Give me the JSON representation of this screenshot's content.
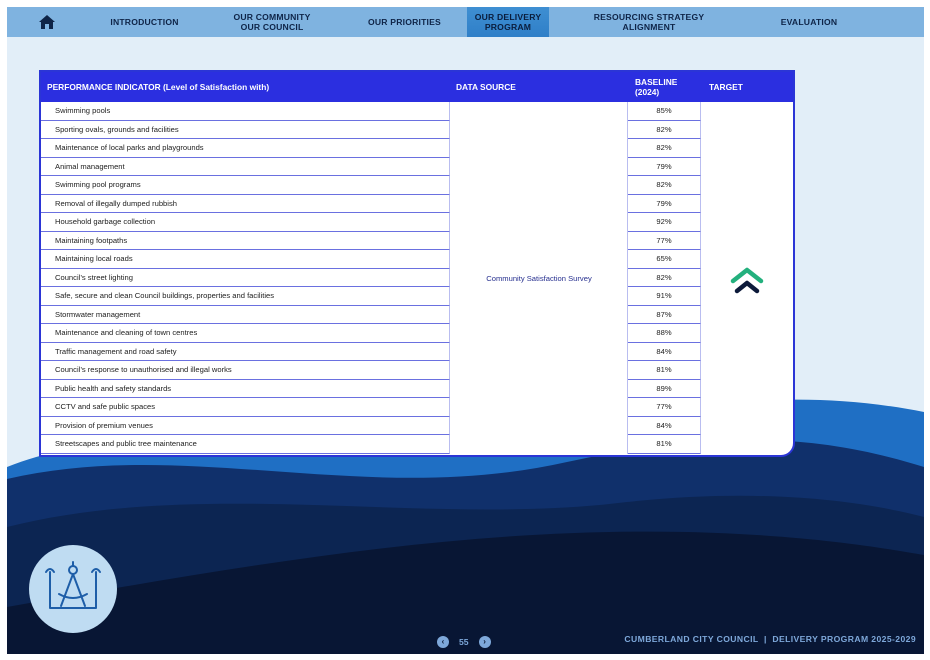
{
  "nav": {
    "items": [
      {
        "label": "INTRODUCTION",
        "active": false
      },
      {
        "label": "OUR COMMUNITY\nOUR COUNCIL",
        "active": false
      },
      {
        "label": "OUR PRIORITIES",
        "active": false
      },
      {
        "label": "OUR DELIVERY\nPROGRAM",
        "active": true
      },
      {
        "label": "RESOURCING STRATEGY\nALIGNMENT",
        "active": false
      },
      {
        "label": "EVALUATION",
        "active": false
      }
    ]
  },
  "table": {
    "headers": {
      "indicator": "PERFORMANCE INDICATOR (Level of Satisfaction with)",
      "source": "DATA SOURCE",
      "baseline": "BASELINE\n(2024)",
      "target": "TARGET"
    },
    "data_source": "Community Satisfaction Survey",
    "target_icon": "double-chevron-up-icon",
    "rows": [
      {
        "indicator": "Swimming pools",
        "baseline": "85%"
      },
      {
        "indicator": "Sporting ovals, grounds and facilities",
        "baseline": "82%"
      },
      {
        "indicator": "Maintenance of local parks and playgrounds",
        "baseline": "82%"
      },
      {
        "indicator": "Animal management",
        "baseline": "79%"
      },
      {
        "indicator": "Swimming pool programs",
        "baseline": "82%"
      },
      {
        "indicator": "Removal of illegally dumped rubbish",
        "baseline": "79%"
      },
      {
        "indicator": "Household garbage collection",
        "baseline": "92%"
      },
      {
        "indicator": "Maintaining footpaths",
        "baseline": "77%"
      },
      {
        "indicator": "Maintaining local roads",
        "baseline": "65%"
      },
      {
        "indicator": "Council’s street lighting",
        "baseline": "82%"
      },
      {
        "indicator": "Safe, secure and clean Council buildings, properties and facilities",
        "baseline": "91%"
      },
      {
        "indicator": "Stormwater management",
        "baseline": "87%"
      },
      {
        "indicator": "Maintenance and cleaning of town centres",
        "baseline": "88%"
      },
      {
        "indicator": "Traffic management and road safety",
        "baseline": "84%"
      },
      {
        "indicator": "Council’s response to unauthorised and illegal works",
        "baseline": "81%"
      },
      {
        "indicator": "Public health and safety standards",
        "baseline": "89%"
      },
      {
        "indicator": "CCTV and safe public spaces",
        "baseline": "77%"
      },
      {
        "indicator": "Provision of premium venues",
        "baseline": "84%"
      },
      {
        "indicator": "Streetscapes and public tree maintenance",
        "baseline": "81%"
      }
    ]
  },
  "footer": {
    "page_number": "55",
    "prev_icon": "chevron-left-icon",
    "next_icon": "chevron-right-icon",
    "text": "CUMBERLAND CITY COUNCIL  |  DELIVERY PROGRAM 2025-2029"
  },
  "colors": {
    "header_blue": "#2b2fe0",
    "nav_blue": "#7fb3e0",
    "navy": "#0d1a3a",
    "target_green": "#23b07d"
  }
}
